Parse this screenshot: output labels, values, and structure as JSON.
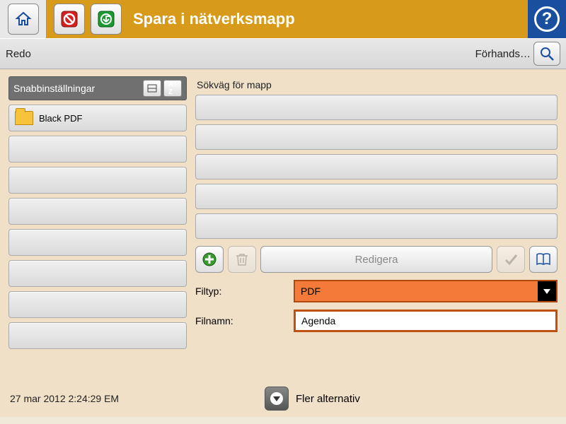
{
  "titlebar": {
    "title": "Spara i nätverksmapp"
  },
  "statusbar": {
    "status": "Redo",
    "preview": "Förhands…"
  },
  "quicksets": {
    "header": "Snabbinställningar",
    "items": [
      "Black PDF",
      "",
      "",
      "",
      "",
      "",
      "",
      ""
    ]
  },
  "path": {
    "label": "Sökväg för mapp",
    "edit": "Redigera"
  },
  "filetype": {
    "label": "Filtyp:",
    "value": "PDF"
  },
  "filename": {
    "label": "Filnamn:",
    "value": "Agenda"
  },
  "footer": {
    "timestamp": "27 mar 2012 2:24:29 EM",
    "more": "Fler alternativ"
  }
}
